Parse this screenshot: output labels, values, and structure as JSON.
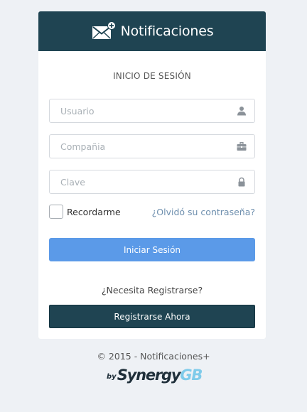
{
  "header": {
    "title": "Notificaciones",
    "icon": "envelope-plus-icon",
    "background": "#1f4452"
  },
  "login": {
    "section_title": "INICIO DE SESIÓN",
    "username_placeholder": "Usuario",
    "username_icon": "user-icon",
    "company_placeholder": "Compañia",
    "company_icon": "briefcase-icon",
    "password_placeholder": "Clave",
    "password_icon": "lock-icon",
    "remember_label": "Recordarme",
    "remember_checked": false,
    "forgot_link": "¿Olvidó su contraseña?",
    "submit_label": "Iniciar Sesión",
    "submit_color": "#5b9ae8"
  },
  "register": {
    "prompt": "¿Necesita Registrarse?",
    "button_label": "Registrarse Ahora",
    "button_color": "#1f4452"
  },
  "footer": {
    "copyright": "© 2015 - Notificaciones+",
    "logo_by": "by",
    "logo_main": "Synergy",
    "logo_accent": "GB",
    "logo_accent_color": "#7fcbea"
  }
}
